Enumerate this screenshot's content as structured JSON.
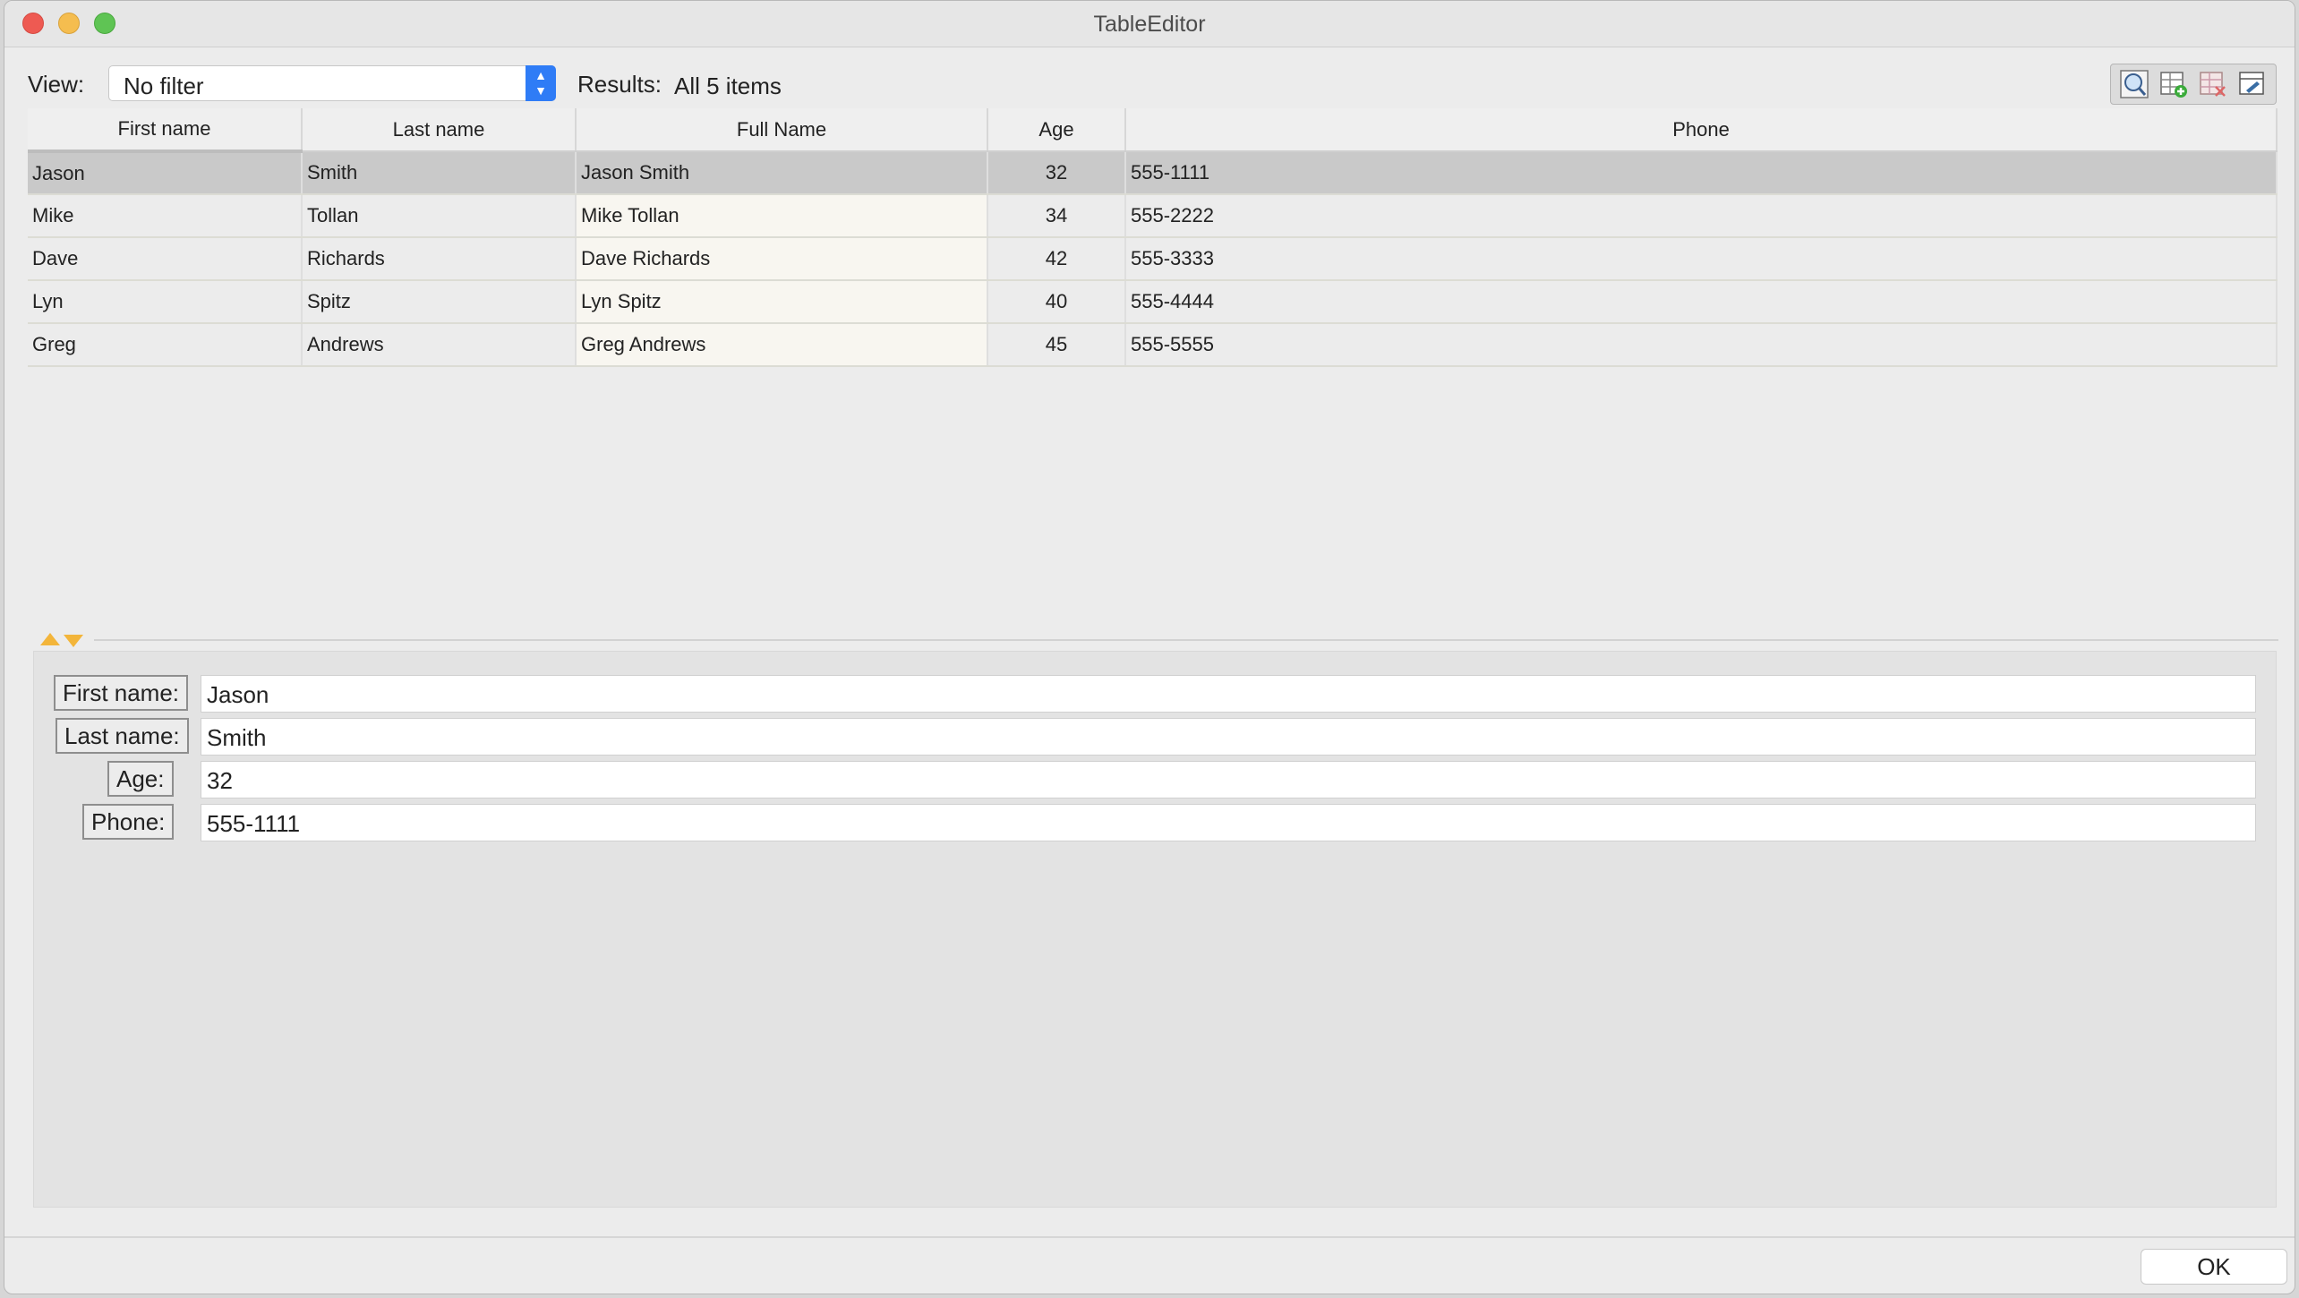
{
  "window": {
    "title": "TableEditor"
  },
  "toolbar": {
    "view_label": "View:",
    "view_value": "No filter",
    "results_label": "Results:",
    "results_value": "All 5 items"
  },
  "table": {
    "columns": [
      "First name",
      "Last name",
      "Full Name",
      "Age",
      "Phone"
    ],
    "rows": [
      {
        "first": "Jason",
        "last": "Smith",
        "full": "Jason Smith",
        "age": "32",
        "phone": "555-1111"
      },
      {
        "first": "Mike",
        "last": "Tollan",
        "full": "Mike Tollan",
        "age": "34",
        "phone": "555-2222"
      },
      {
        "first": "Dave",
        "last": "Richards",
        "full": "Dave Richards",
        "age": "42",
        "phone": "555-3333"
      },
      {
        "first": "Lyn",
        "last": "Spitz",
        "full": "Lyn Spitz",
        "age": "40",
        "phone": "555-4444"
      },
      {
        "first": "Greg",
        "last": "Andrews",
        "full": "Greg Andrews",
        "age": "45",
        "phone": "555-5555"
      }
    ]
  },
  "detail": {
    "first_label": "First name:",
    "first_value": "Jason",
    "last_label": "Last name:",
    "last_value": "Smith",
    "age_label": "Age:",
    "age_value": "32",
    "phone_label": "Phone:",
    "phone_value": "555-1111"
  },
  "footer": {
    "ok_label": "OK"
  },
  "colors": {
    "accent": "#2f7cf6",
    "selected_row": "#c9c9c9",
    "splitter_arrow": "#f3b53a"
  }
}
